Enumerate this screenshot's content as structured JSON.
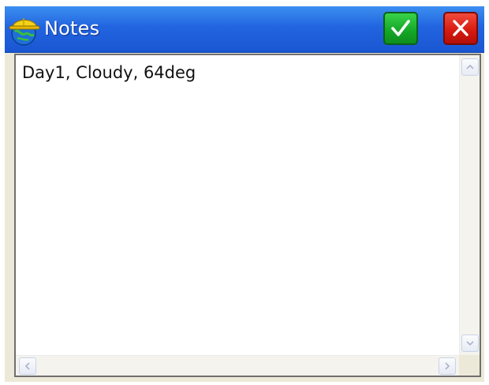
{
  "window": {
    "title": "Notes",
    "icon": "hard-hat-globe-icon"
  },
  "toolbar": {
    "ok_icon": "checkmark-icon",
    "cancel_icon": "close-icon",
    "ok_color": "#14a626",
    "cancel_color": "#d5190f"
  },
  "notes": {
    "text": "Day1, Cloudy, 64deg"
  },
  "scrollbars": {
    "up_icon": "chevron-up-icon",
    "down_icon": "chevron-down-icon",
    "left_icon": "chevron-left-icon",
    "right_icon": "chevron-right-icon"
  },
  "colors": {
    "titlebar": "#2264e0",
    "window_bg": "#ece9d8",
    "text_area_bg": "#ffffff"
  }
}
